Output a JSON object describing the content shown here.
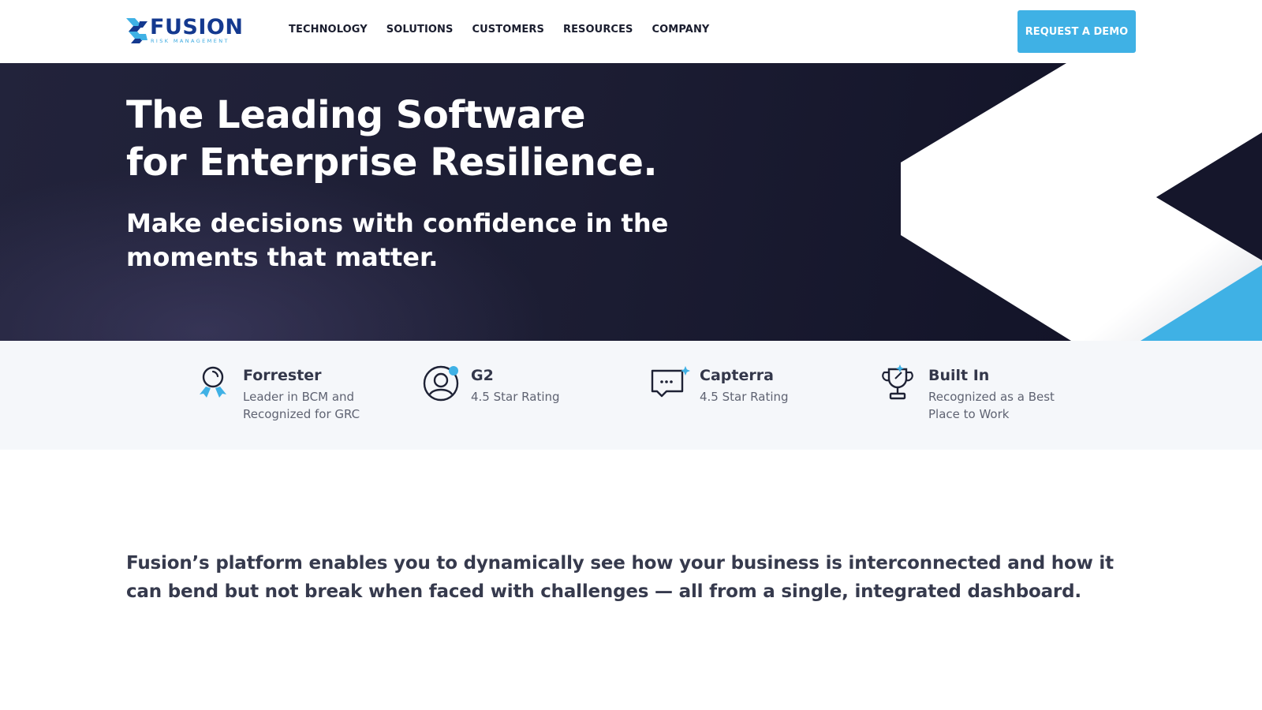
{
  "brand": {
    "name": "FUSION",
    "tagline": "RISK MANAGEMENT",
    "colors": {
      "navy": "#14398f",
      "accent": "#3fb1e5",
      "hero_bg": "#1a1b30"
    }
  },
  "nav": {
    "items": [
      {
        "label": "TECHNOLOGY"
      },
      {
        "label": "SOLUTIONS"
      },
      {
        "label": "CUSTOMERS"
      },
      {
        "label": "RESOURCES"
      },
      {
        "label": "COMPANY"
      }
    ],
    "cta_label": "REQUEST A DEMO"
  },
  "hero": {
    "title_line1": "The Leading Software",
    "title_line2": "for Enterprise Resilience.",
    "subtitle_line1": "Make decisions with confidence in the",
    "subtitle_line2": "moments that matter."
  },
  "awards": [
    {
      "name": "Forrester",
      "description": "Leader in BCM and Recognized for GRC",
      "icon": "ribbon-medal-icon"
    },
    {
      "name": "G2",
      "description": "4.5 Star Rating",
      "icon": "user-circle-icon"
    },
    {
      "name": "Capterra",
      "description": "4.5 Star Rating",
      "icon": "chat-bubble-icon"
    },
    {
      "name": "Built In",
      "description": "Recognized as a Best Place to Work",
      "icon": "trophy-icon"
    }
  ],
  "intro": {
    "text": "Fusion’s platform enables you to dynamically see how your business is interconnected and how it can bend but not break when faced with challenges — all from a single, integrated dashboard."
  }
}
